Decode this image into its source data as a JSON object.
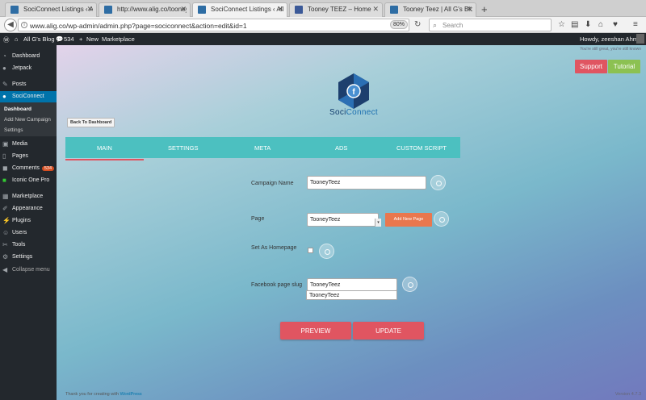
{
  "browser": {
    "tabs": [
      {
        "title": "SociConnect Listings ‹ All G's"
      },
      {
        "title": "http://www.alig.co/tooneyte"
      },
      {
        "title": "SociConnect Listings ‹ All G's"
      },
      {
        "title": "Tooney TEEZ – Home"
      },
      {
        "title": "Tooney Teez | All G's Blog"
      }
    ],
    "new_tab": "+",
    "url": "www.alig.co/wp-admin/admin.php?page=sociconnect&action=edit&id=1",
    "zoom": "80%",
    "search_placeholder": "Search"
  },
  "adminbar": {
    "site_name": "All G's Blog",
    "comments_count": "534",
    "new_label": "New",
    "marketplace_label": "Marketplace",
    "greeting": "Howdy, zeeshan Ahmed"
  },
  "sidebar": {
    "items": [
      {
        "label": "Dashboard"
      },
      {
        "label": "Jetpack"
      },
      {
        "label": "Posts"
      },
      {
        "label": "SociConnect"
      },
      {
        "label": "Media"
      },
      {
        "label": "Pages"
      },
      {
        "label": "Comments",
        "badge": "534"
      },
      {
        "label": "Iconic One Pro"
      },
      {
        "label": "Marketplace"
      },
      {
        "label": "Appearance"
      },
      {
        "label": "Plugins"
      },
      {
        "label": "Users"
      },
      {
        "label": "Tools"
      },
      {
        "label": "Settings"
      },
      {
        "label": "Collapse menu"
      }
    ],
    "submenu": [
      {
        "label": "Dashboard"
      },
      {
        "label": "Add New Campaign"
      },
      {
        "label": "Settings"
      }
    ]
  },
  "main": {
    "top_note": "You're still great, you're still known",
    "support_label": "Support",
    "tutorial_label": "Tutorial",
    "logo_text_a": "Soci",
    "logo_text_b": "Connect",
    "back_button": "Back To Dashboard",
    "tabs": [
      {
        "label": "MAIN"
      },
      {
        "label": "SETTINGS"
      },
      {
        "label": "META"
      },
      {
        "label": "ADS"
      },
      {
        "label": "CUSTOM SCRIPT"
      }
    ],
    "form": {
      "campaign_name_label": "Campaign Name",
      "campaign_name_value": "TooneyTeez",
      "page_label": "Page",
      "page_value": "TooneyTeez",
      "add_new_page_label": "Add New Page",
      "set_homepage_label": "Set As Homepage",
      "slug_label": "Facebook page slug",
      "slug_value": "TooneyTeez",
      "autocomplete_option": "TooneyTeez"
    },
    "preview_label": "PREVIEW",
    "update_label": "UPDATE",
    "footer_left_a": "Thank you for creating with ",
    "footer_left_b": "WordPress",
    "footer_right": "Version 4.7.3"
  },
  "colors": {
    "accent_red": "#e05561",
    "accent_green": "#8cc152",
    "tab_teal": "#4cc0c0",
    "wp_blue": "#0073aa",
    "add_page_orange": "#e9774e"
  }
}
